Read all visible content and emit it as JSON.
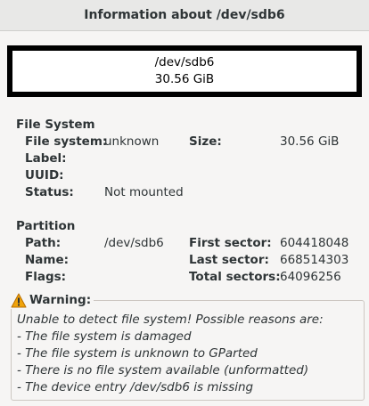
{
  "window": {
    "title": "Information about /dev/sdb6"
  },
  "graphic": {
    "device": "/dev/sdb6",
    "size": "30.56 GiB"
  },
  "filesystem": {
    "heading": "File System",
    "fs_label": "File system:",
    "fs_value": "unknown",
    "size_label": "Size:",
    "size_value": "30.56 GiB",
    "label_label": "Label:",
    "label_value": "",
    "uuid_label": "UUID:",
    "uuid_value": "",
    "status_label": "Status:",
    "status_value": "Not mounted"
  },
  "partition": {
    "heading": "Partition",
    "path_label": "Path:",
    "path_value": "/dev/sdb6",
    "first_label": "First sector:",
    "first_value": "604418048",
    "name_label": "Name:",
    "name_value": "",
    "last_label": "Last sector:",
    "last_value": "668514303",
    "flags_label": "Flags:",
    "flags_value": "",
    "total_label": "Total sectors:",
    "total_value": "64096256"
  },
  "warning": {
    "heading": "Warning:",
    "icon": "warning-icon",
    "lines": [
      "Unable to detect file system! Possible reasons are:",
      "- The file system is damaged",
      "- The file system is unknown to GParted",
      "- There is no file system available (unformatted)",
      "- The device entry /dev/sdb6 is missing"
    ]
  }
}
